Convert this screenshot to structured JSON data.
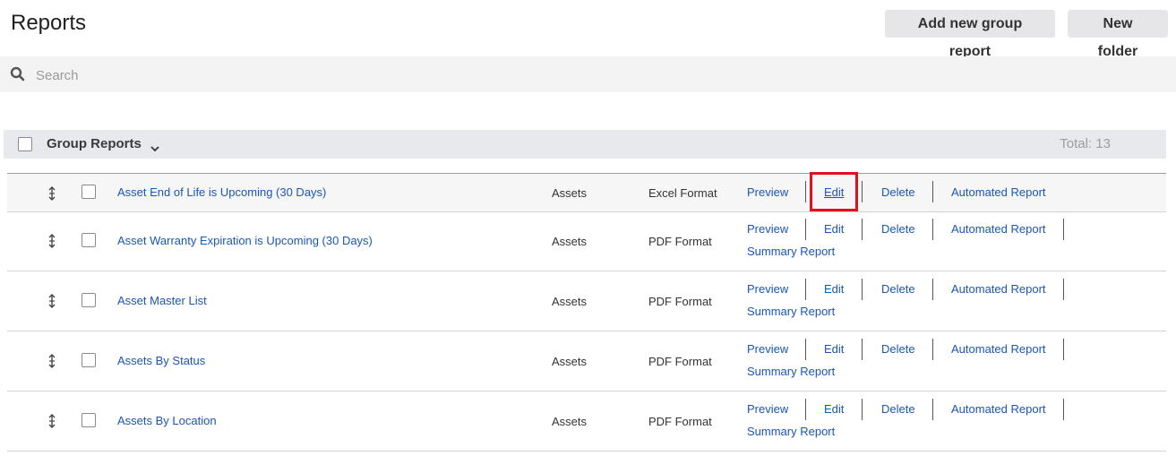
{
  "header": {
    "title": "Reports",
    "add_group_report_label": "Add new group report",
    "new_folder_label": "New folder"
  },
  "search": {
    "placeholder": "Search",
    "value": ""
  },
  "group": {
    "title": "Group Reports",
    "total": "Total: 13"
  },
  "actions": {
    "preview": "Preview",
    "edit": "Edit",
    "delete": "Delete",
    "automated": "Automated Report",
    "summary": "Summary Report"
  },
  "rows": [
    {
      "name": "Asset End of Life is Upcoming (30 Days)",
      "module": "Assets",
      "format": "Excel Format"
    },
    {
      "name": "Asset Warranty Expiration is Upcoming (30 Days)",
      "module": "Assets",
      "format": "PDF Format"
    },
    {
      "name": "Asset Master List",
      "module": "Assets",
      "format": "PDF Format"
    },
    {
      "name": "Assets By Status",
      "module": "Assets",
      "format": "PDF Format"
    },
    {
      "name": "Assets By Location",
      "module": "Assets",
      "format": "PDF Format"
    }
  ],
  "colors": {
    "link": "#1a56b8",
    "highlight_box": "#e0101e",
    "header_bg": "#e8e9ec"
  },
  "icons": [
    "search-icon",
    "chevron-down-icon",
    "drag-handle-icon"
  ]
}
